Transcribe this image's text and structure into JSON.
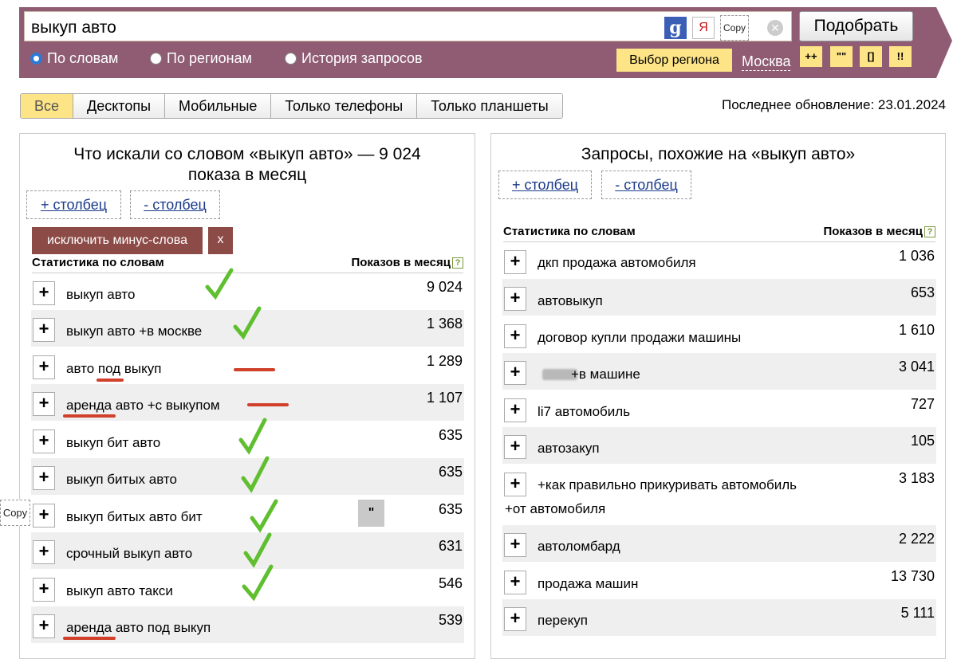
{
  "search": {
    "query": "выкуп авто",
    "submit_label": "Подобрать",
    "copy_label": "Copy"
  },
  "modes": [
    {
      "label": "По словам",
      "selected": true
    },
    {
      "label": "По регионам",
      "selected": false
    },
    {
      "label": "История запросов",
      "selected": false
    }
  ],
  "region": {
    "button_label": "Выбор региона",
    "city": "Москва"
  },
  "operators": [
    "++",
    "\"\"",
    "[]",
    "!!"
  ],
  "tabs": [
    "Все",
    "Десктопы",
    "Мобильные",
    "Только телефоны",
    "Только планшеты"
  ],
  "last_update": "Последнее обновление: 23.01.2024",
  "left": {
    "title_line1": "Что искали со словом «выкуп авто» — 9 024",
    "title_line2": "показа в месяц",
    "add_col": "+ столбец",
    "remove_col": "- столбец",
    "exclude_label": "исключить минус-слова",
    "exclude_close": "x",
    "col_words": "Статистика по словам",
    "col_count": "Показов в месяц",
    "quote_label": "\"",
    "copy_label": "Copy",
    "rows": [
      {
        "kw": "выкуп авто",
        "count": "9 024"
      },
      {
        "kw": "выкуп авто +в москве",
        "count": "1 368"
      },
      {
        "kw": "авто под выкуп",
        "count": "1 289"
      },
      {
        "kw": "аренда авто +с выкупом",
        "count": "1 107"
      },
      {
        "kw": "выкуп бит авто",
        "count": "635"
      },
      {
        "kw": "выкуп битых авто",
        "count": "635"
      },
      {
        "kw": "выкуп битых авто бит",
        "count": "635"
      },
      {
        "kw": "срочный выкуп авто",
        "count": "631"
      },
      {
        "kw": "выкуп авто такси",
        "count": "546"
      },
      {
        "kw": "аренда авто под выкуп",
        "count": "539"
      }
    ]
  },
  "right": {
    "title": "Запросы, похожие на «выкуп авто»",
    "add_col": "+ столбец",
    "remove_col": "- столбец",
    "col_words": "Статистика по словам",
    "col_count": "Показов в месяц",
    "rows": [
      {
        "kw": "дкп продажа автомобиля",
        "count": "1 036"
      },
      {
        "kw": "автовыкуп",
        "count": "653"
      },
      {
        "kw": "договор купли продажи машины",
        "count": "1 610"
      },
      {
        "kw": "+в машине",
        "count": "3 041"
      },
      {
        "kw": "li7 автомобиль",
        "count": "727"
      },
      {
        "kw": "автозакуп",
        "count": "105"
      },
      {
        "kw": "+как правильно прикуривать автомобиль",
        "kw_line2": "+от автомобиля",
        "count": "3 183"
      },
      {
        "kw": "автоломбард",
        "count": "2 222"
      },
      {
        "kw": "продажа машин",
        "count": "13 730"
      },
      {
        "kw": "перекуп",
        "count": "5 111"
      }
    ]
  }
}
